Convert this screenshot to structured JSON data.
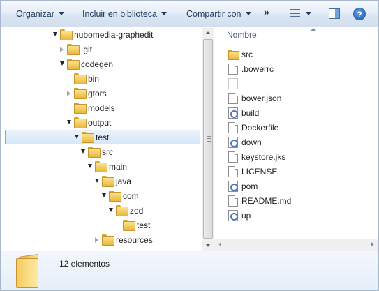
{
  "toolbar": {
    "organize_label": "Organizar",
    "include_label": "Incluir en biblioteca",
    "share_label": "Compartir con",
    "more_label": "»",
    "views_icon": "view-list-icon",
    "preview_pane_icon": "preview-pane-icon",
    "help_label": "?"
  },
  "nav": {
    "tree": [
      {
        "label": "nubomedia-graphedit",
        "level": 0,
        "expander": "open",
        "selected": false
      },
      {
        "label": ".git",
        "level": 1,
        "expander": "closed",
        "selected": false
      },
      {
        "label": "codegen",
        "level": 1,
        "expander": "open",
        "selected": false
      },
      {
        "label": "bin",
        "level": 2,
        "expander": "none",
        "selected": false
      },
      {
        "label": "gtors",
        "level": 2,
        "expander": "closed",
        "selected": false
      },
      {
        "label": "models",
        "level": 2,
        "expander": "none",
        "selected": false
      },
      {
        "label": "output",
        "level": 2,
        "expander": "open",
        "selected": false
      },
      {
        "label": "test",
        "level": 3,
        "expander": "open",
        "selected": true
      },
      {
        "label": "src",
        "level": 4,
        "expander": "open",
        "selected": false
      },
      {
        "label": "main",
        "level": 5,
        "expander": "open",
        "selected": false
      },
      {
        "label": "java",
        "level": 6,
        "expander": "open",
        "selected": false
      },
      {
        "label": "com",
        "level": 7,
        "expander": "open",
        "selected": false
      },
      {
        "label": "zed",
        "level": 8,
        "expander": "open",
        "selected": false
      },
      {
        "label": "test",
        "level": 9,
        "expander": "none",
        "selected": false
      },
      {
        "label": "resources",
        "level": 6,
        "expander": "closed",
        "selected": false
      }
    ]
  },
  "content": {
    "column_name": "Nombre",
    "files": [
      {
        "label": "src",
        "icon": "folder-icon"
      },
      {
        "label": ".bowerrc",
        "icon": "file-icon"
      },
      {
        "label": "",
        "icon": "blank-file-icon"
      },
      {
        "label": "bower.json",
        "icon": "file-icon"
      },
      {
        "label": "build",
        "icon": "script-icon"
      },
      {
        "label": "Dockerfile",
        "icon": "file-icon"
      },
      {
        "label": "down",
        "icon": "script-icon"
      },
      {
        "label": "keystore.jks",
        "icon": "file-icon"
      },
      {
        "label": "LICENSE",
        "icon": "file-icon"
      },
      {
        "label": "pom",
        "icon": "script-icon"
      },
      {
        "label": "README.md",
        "icon": "file-icon"
      },
      {
        "label": "up",
        "icon": "script-icon"
      }
    ]
  },
  "details": {
    "count_text": "12 elementos"
  },
  "colors": {
    "selection_border": "#84acdd",
    "toolbar_text": "#1e395b"
  }
}
